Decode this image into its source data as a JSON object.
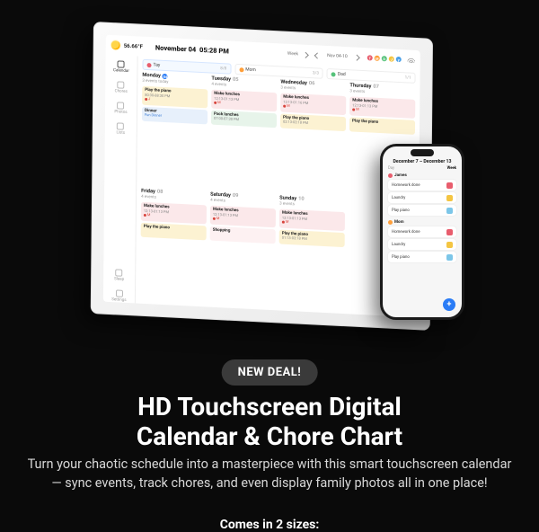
{
  "marketing": {
    "badge": "NEW DEAL!",
    "headline_l1": "HD Touchscreen Digital",
    "headline_l2": "Calendar & Chore Chart",
    "sub": "Turn your chaotic schedule into a masterpiece with this smart touchscreen calendar — sync events, track chores, and even display family photos all in one place!",
    "sizes": "Comes in 2 sizes:"
  },
  "screen": {
    "temp": "56.66°F",
    "date": "November 04",
    "time": "05:28 PM",
    "view_label": "Week",
    "range": "Nov 04-10",
    "avatars": [
      {
        "letter": "T",
        "color": "#e85d6d"
      },
      {
        "letter": "M",
        "color": "#ff9f3a"
      },
      {
        "letter": "D",
        "color": "#55c27a"
      },
      {
        "letter": "J",
        "color": "#f4c542"
      },
      {
        "letter": "y",
        "color": "#4aa0e8"
      }
    ]
  },
  "nav": [
    {
      "label": "Calendar"
    },
    {
      "label": "Chores"
    },
    {
      "label": "Photos"
    },
    {
      "label": "Lists"
    },
    {
      "label": "Sleep"
    },
    {
      "label": "Settings"
    }
  ],
  "people": [
    {
      "name": "Tay",
      "count": "8/8",
      "color": "#e85d6d",
      "selected": true
    },
    {
      "name": "Mom",
      "count": "3/3",
      "color": "#ff9f3a",
      "selected": false
    },
    {
      "name": "Dad",
      "count": "1/1",
      "color": "#55c27a",
      "selected": false
    }
  ],
  "days_row1": [
    {
      "name": "Monday",
      "num": "04",
      "count": "3 events today",
      "today": true
    },
    {
      "name": "Tuesday",
      "num": "05",
      "count": "4 events",
      "today": false
    },
    {
      "name": "Wednesday",
      "num": "06",
      "count": "3 events",
      "today": false
    },
    {
      "name": "Thursday",
      "num": "07",
      "count": "3 events",
      "today": false
    }
  ],
  "days_row2": [
    {
      "name": "Friday",
      "num": "08",
      "count": "4 events"
    },
    {
      "name": "Saturday",
      "num": "09",
      "count": "4 events"
    },
    {
      "name": "Sunday",
      "num": "10",
      "count": "3 events"
    },
    {
      "name": "",
      "num": "",
      "count": ""
    }
  ],
  "events_row1": {
    "c0": [
      {
        "title": "Play the piano",
        "sub": "80:30-88:30 PM",
        "cls": "c-yellow"
      },
      {
        "title": "Dinner",
        "sub": "Fun Dinner",
        "cls": "c-blue"
      }
    ],
    "c1": [
      {
        "title": "Make lunches",
        "sub": "12:13-01:13 PM",
        "mark": "M",
        "cls": "c-pink"
      },
      {
        "title": "Pack lunches",
        "sub": "07:00-07:30 PM",
        "cls": "c-green"
      }
    ],
    "c2": [
      {
        "title": "Make lunches",
        "sub": "12:13-01:16 PM",
        "mark": "M",
        "cls": "c-pink"
      },
      {
        "title": "Play the piano",
        "sub": "02:13-03:18 PM",
        "cls": "c-yellow"
      }
    ],
    "c3": [
      {
        "title": "Make lunches",
        "sub": "12:13-01:13 PM",
        "mark": "M",
        "cls": "c-pink"
      },
      {
        "title": "Play the piano",
        "sub": "",
        "cls": "c-yellow"
      }
    ]
  },
  "events_row2": {
    "c0": [
      {
        "title": "Make lunches",
        "sub": "12:13-01:13 PM",
        "mark": "M",
        "cls": "c-pink"
      },
      {
        "title": "Play the piano",
        "sub": "",
        "cls": "c-yellow"
      }
    ],
    "c1": [
      {
        "title": "Make lunches",
        "sub": "12:13-01:13 PM",
        "mark": "M",
        "cls": "c-pink"
      },
      {
        "title": "Shopping",
        "sub": "",
        "cls": "c-lpink"
      }
    ],
    "c2": [
      {
        "title": "Make lunches",
        "sub": "12:13-01:13 PM",
        "mark": "M",
        "cls": "c-pink"
      },
      {
        "title": "Play the piano",
        "sub": "01:13-03:18 PM",
        "cls": "c-yellow"
      }
    ],
    "c3": []
  },
  "phone": {
    "range": "December 7 – December 13",
    "tab_left": "Day",
    "tab_right": "Week",
    "sections": [
      {
        "name": "James",
        "color": "#e85d6d",
        "chores": [
          {
            "label": "Homework done",
            "color": "#e85d6d"
          },
          {
            "label": "Laundry",
            "color": "#f4c542"
          },
          {
            "label": "Play piano",
            "color": "#7cc6e8"
          }
        ]
      },
      {
        "name": "Mom",
        "color": "#ff9f3a",
        "chores": [
          {
            "label": "Homework done",
            "color": "#e85d6d"
          },
          {
            "label": "Laundry",
            "color": "#f4c542"
          },
          {
            "label": "Play piano",
            "color": "#7cc6e8"
          }
        ]
      }
    ],
    "fab": "+"
  }
}
